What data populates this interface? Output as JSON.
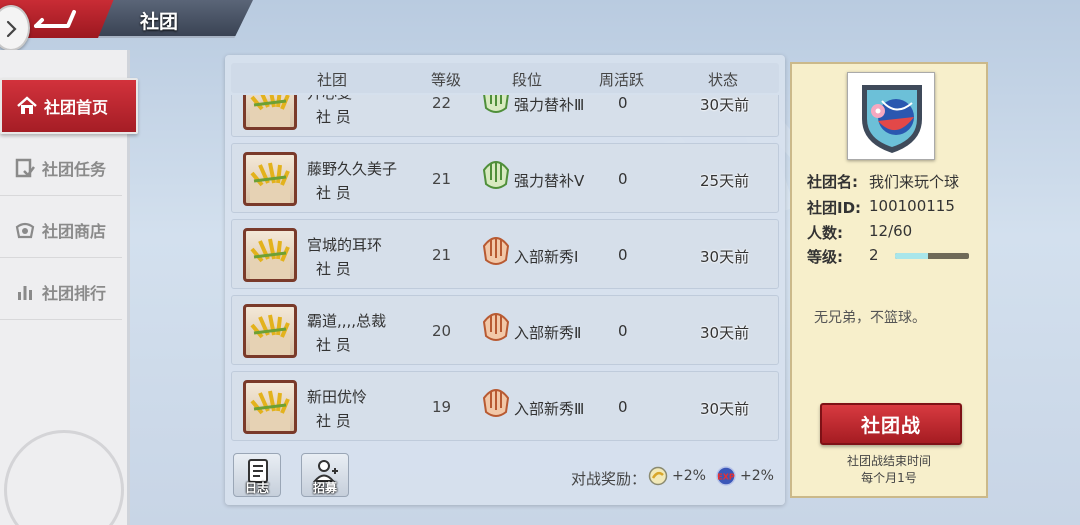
{
  "header": {
    "title": "社团"
  },
  "sidebar": {
    "items": [
      {
        "label": "社团首页",
        "icon": "home-icon",
        "active": true
      },
      {
        "label": "社团任务",
        "icon": "task-icon",
        "active": false
      },
      {
        "label": "社团商店",
        "icon": "shop-icon",
        "active": false
      },
      {
        "label": "社团排行",
        "icon": "ranking-icon",
        "active": false
      }
    ]
  },
  "table": {
    "columns": [
      "社团",
      "等级",
      "段位",
      "周活跃",
      "状态"
    ],
    "rows": [
      {
        "name": "开心雯",
        "role": "社 员",
        "level": "22",
        "rank": "强力替补Ⅲ",
        "weekly": "0",
        "status": "30天前",
        "badge": "green"
      },
      {
        "name": "藤野久久美子",
        "role": "社 员",
        "level": "21",
        "rank": "强力替补Ⅴ",
        "weekly": "0",
        "status": "25天前",
        "badge": "green"
      },
      {
        "name": "宫城的耳环",
        "role": "社 员",
        "level": "21",
        "rank": "入部新秀Ⅰ",
        "weekly": "0",
        "status": "30天前",
        "badge": "orange"
      },
      {
        "name": "霸道,,,,总裁",
        "role": "社 员",
        "level": "20",
        "rank": "入部新秀Ⅱ",
        "weekly": "0",
        "status": "30天前",
        "badge": "orange"
      },
      {
        "name": "新田优怜",
        "role": "社 员",
        "level": "19",
        "rank": "入部新秀Ⅲ",
        "weekly": "0",
        "status": "30天前",
        "badge": "orange"
      }
    ]
  },
  "footer": {
    "log_label": "日志",
    "recruit_label": "招募",
    "reward_label": "对战奖励：",
    "reward_coin": "+2%",
    "reward_exp": "+2%",
    "exp_badge": "EXP"
  },
  "club": {
    "name_key": "社团名:",
    "name": "我们来玩个球",
    "id_key": "社团ID:",
    "id": "100100115",
    "members_key": "人数:",
    "members": "12/60",
    "level_key": "等级:",
    "level": "2",
    "level_progress": 0.45,
    "motto": "无兄弟，不篮球。",
    "war_button": "社团战",
    "war_note_1": "社团战结束时间",
    "war_note_2": "每个月1号"
  },
  "colors": {
    "accent_red": "#c92c35",
    "panel_cream": "#f7efcb",
    "progress": "#a9e6ea"
  }
}
